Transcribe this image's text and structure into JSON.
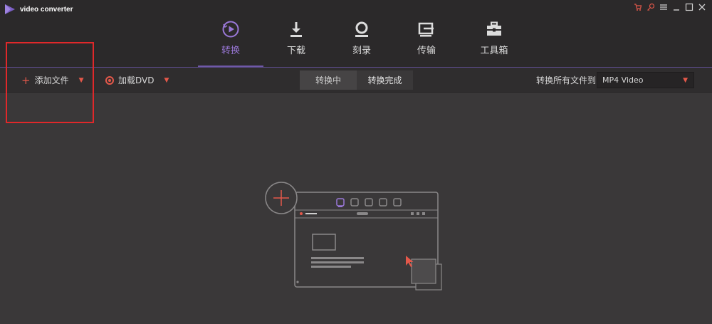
{
  "app": {
    "title": "video converter"
  },
  "nav": {
    "items": [
      {
        "label": "转换",
        "icon": "convert-icon",
        "active": true
      },
      {
        "label": "下载",
        "icon": "download-icon",
        "active": false
      },
      {
        "label": "刻录",
        "icon": "burn-icon",
        "active": false
      },
      {
        "label": "传输",
        "icon": "transfer-icon",
        "active": false
      },
      {
        "label": "工具箱",
        "icon": "toolbox-icon",
        "active": false
      }
    ]
  },
  "toolbar": {
    "add_files_label": "添加文件",
    "load_dvd_label": "加载DVD",
    "tabs": [
      {
        "label": "转换中",
        "selected": true
      },
      {
        "label": "转换完成",
        "selected": false
      }
    ],
    "convert_all_label": "转换所有文件到:",
    "format_value": "MP4 Video"
  },
  "colors": {
    "accent": "#9a78d8",
    "highlight": "#e4584a",
    "annotation": "#e0282a",
    "background": "#3a3839"
  }
}
